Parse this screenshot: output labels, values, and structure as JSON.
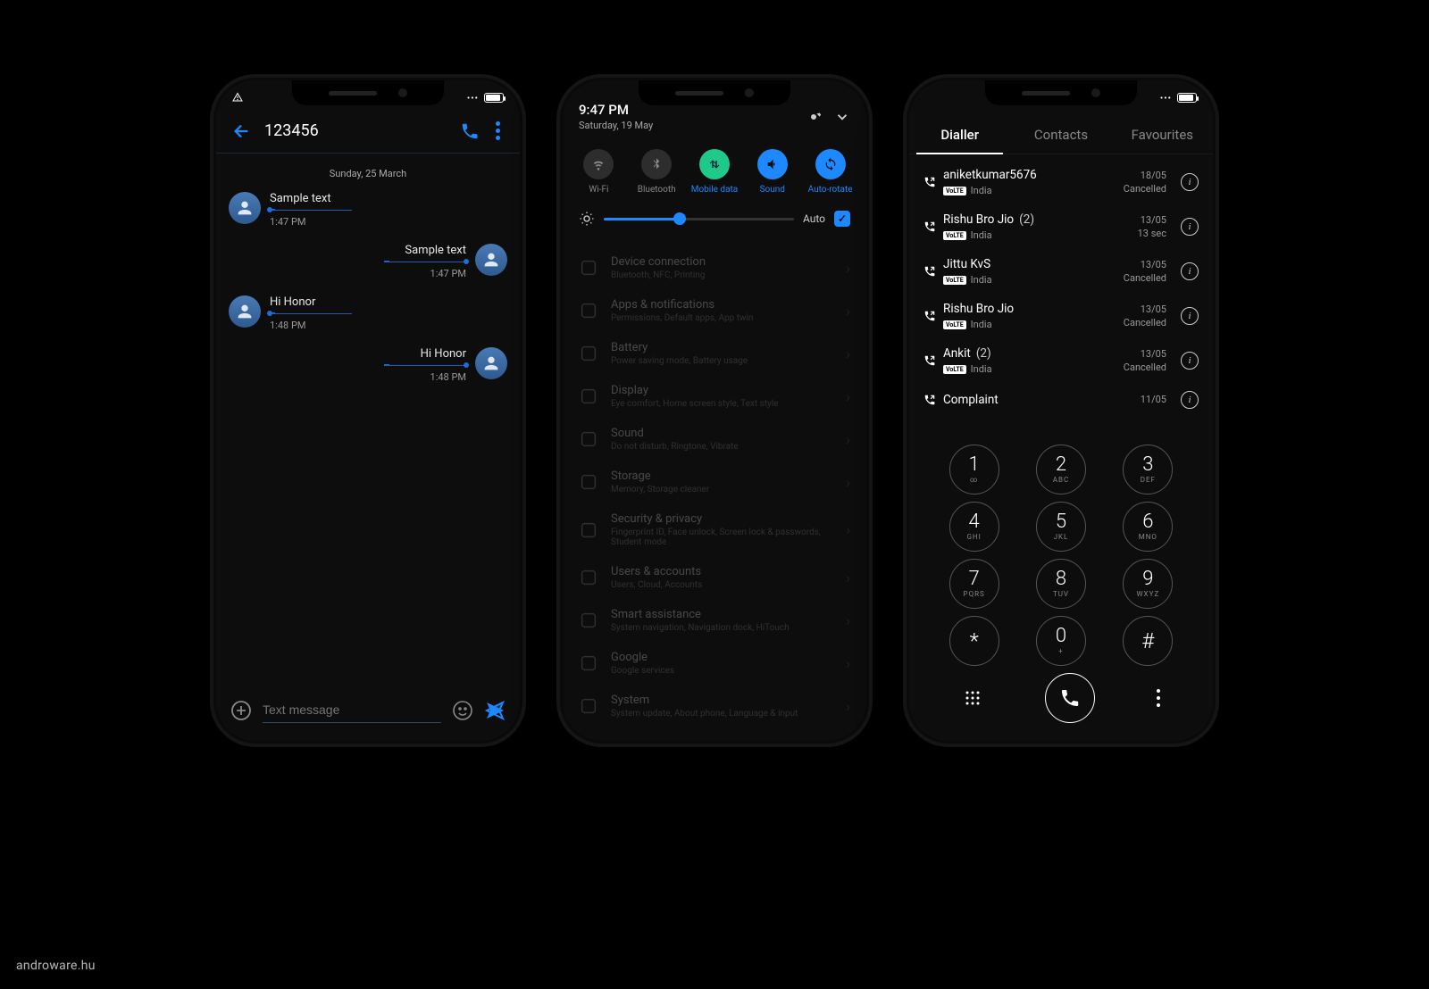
{
  "watermark": "androware.hu",
  "phone1": {
    "title": "123456",
    "date_separator": "Sunday, 25 March",
    "messages": [
      {
        "dir": "in",
        "text": "Sample text",
        "time": "1:47 PM"
      },
      {
        "dir": "out",
        "text": "Sample text",
        "time": "1:47 PM"
      },
      {
        "dir": "in",
        "text": "Hi Honor",
        "time": "1:48 PM"
      },
      {
        "dir": "out",
        "text": "Hi Honor",
        "time": "1:48 PM"
      }
    ],
    "compose_placeholder": "Text message"
  },
  "phone2": {
    "time": "9:47 PM",
    "date": "Saturday, 19 May",
    "toggles": [
      {
        "label": "Wi-Fi",
        "on": false,
        "color": "dim"
      },
      {
        "label": "Bluetooth",
        "on": false,
        "color": "dim"
      },
      {
        "label": "Mobile data",
        "on": true,
        "color": "green",
        "active_label": true
      },
      {
        "label": "Sound",
        "on": true,
        "color": "blue",
        "active_label": true
      },
      {
        "label": "Auto-rotate",
        "on": true,
        "color": "blue",
        "active_label": true
      }
    ],
    "brightness_auto": "Auto",
    "settings": [
      {
        "title": "Device connection",
        "sub": "Bluetooth, NFC, Printing"
      },
      {
        "title": "Apps & notifications",
        "sub": "Permissions, Default apps, App twin"
      },
      {
        "title": "Battery",
        "sub": "Power saving mode, Battery usage"
      },
      {
        "title": "Display",
        "sub": "Eye comfort, Home screen style, Text style"
      },
      {
        "title": "Sound",
        "sub": "Do not disturb, Ringtone, Vibrate"
      },
      {
        "title": "Storage",
        "sub": "Memory, Storage cleaner"
      },
      {
        "title": "Security & privacy",
        "sub": "Fingerprint ID, Face unlock, Screen lock & passwords, Student mode"
      },
      {
        "title": "Users & accounts",
        "sub": "Users, Cloud, Accounts"
      },
      {
        "title": "Smart assistance",
        "sub": "System navigation, Navigation dock, HiTouch"
      },
      {
        "title": "Google",
        "sub": "Google services"
      },
      {
        "title": "System",
        "sub": "System update, About phone, Language & input"
      }
    ]
  },
  "phone3": {
    "tabs": [
      "Dialler",
      "Contacts",
      "Favourites"
    ],
    "active_tab": 0,
    "calls": [
      {
        "name": "aniketkumar5676",
        "count": "",
        "region": "India",
        "date": "18/05",
        "status": "Cancelled"
      },
      {
        "name": "Rishu Bro Jio",
        "count": "(2)",
        "region": "India",
        "date": "13/05",
        "status": "13 sec"
      },
      {
        "name": "Jittu KvS",
        "count": "",
        "region": "India",
        "date": "13/05",
        "status": "Cancelled"
      },
      {
        "name": "Rishu Bro Jio",
        "count": "",
        "region": "India",
        "date": "13/05",
        "status": "Cancelled"
      },
      {
        "name": "Ankit",
        "count": "(2)",
        "region": "India",
        "date": "13/05",
        "status": "Cancelled"
      },
      {
        "name": "Complaint",
        "count": "",
        "region": "",
        "date": "11/05",
        "status": ""
      }
    ],
    "volte_badge": "VoLTE",
    "keys": [
      {
        "n": "1",
        "l": "∞"
      },
      {
        "n": "2",
        "l": "ABC"
      },
      {
        "n": "3",
        "l": "DEF"
      },
      {
        "n": "4",
        "l": "GHI"
      },
      {
        "n": "5",
        "l": "JKL"
      },
      {
        "n": "6",
        "l": "MNO"
      },
      {
        "n": "7",
        "l": "PQRS"
      },
      {
        "n": "8",
        "l": "TUV"
      },
      {
        "n": "9",
        "l": "WXYZ"
      },
      {
        "n": "*",
        "l": ""
      },
      {
        "n": "0",
        "l": "+"
      },
      {
        "n": "#",
        "l": ""
      }
    ]
  }
}
